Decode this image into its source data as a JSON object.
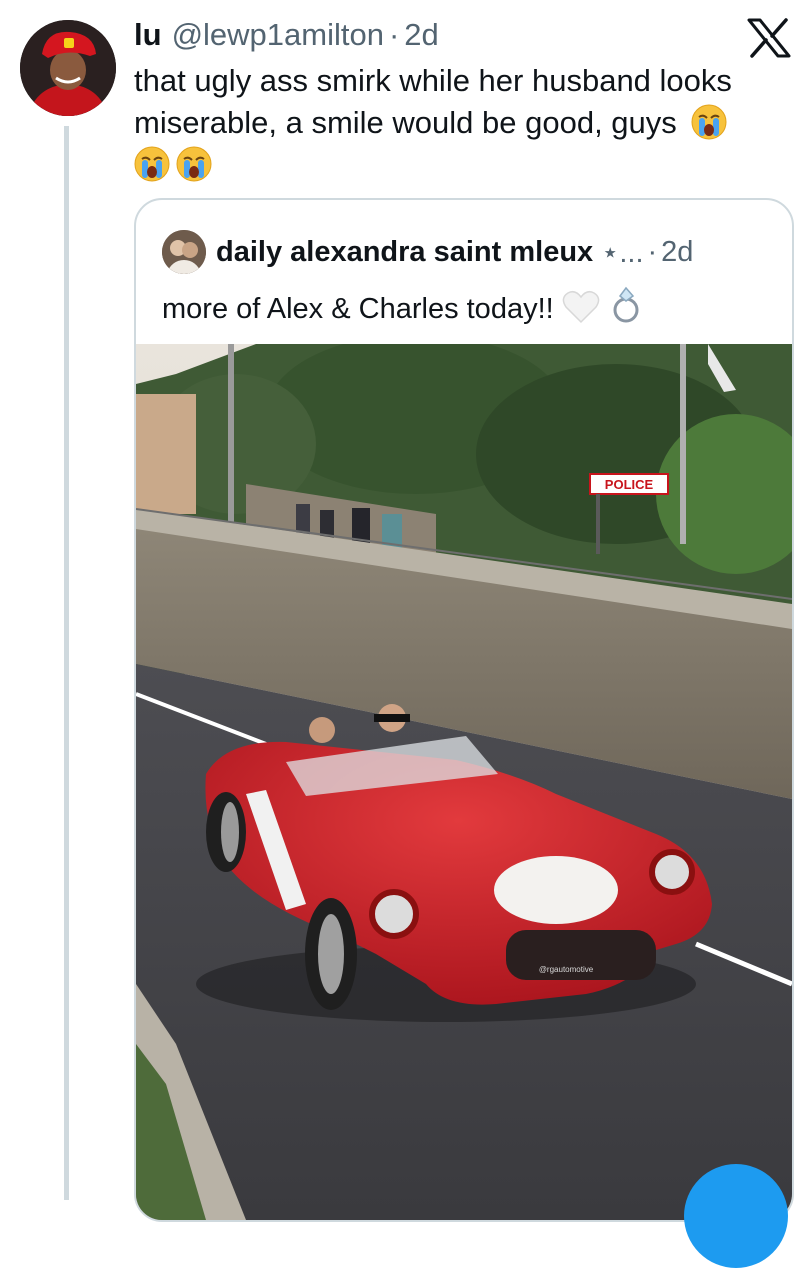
{
  "tweet": {
    "author_name": "lu",
    "author_handle": "@lewp1amilton",
    "separator": "·",
    "time": "2d",
    "text": "that ugly ass smirk while her husband looks miserable, a smile would be good, guys"
  },
  "quote": {
    "author_name": "daily alexandra saint mleux",
    "name_overflow": "⋆...",
    "separator": "·",
    "time": "2d",
    "text": "more of Alex & Charles today!!",
    "media": {
      "sign_text": "POLICE",
      "watermark": "@rgautomotive"
    }
  },
  "icons": {
    "platform_logo": "x-logo-icon",
    "tweet_emoji": "loudly-crying-face-icon",
    "quote_emojis": [
      "white-heart-icon",
      "ring-icon"
    ]
  },
  "colors": {
    "text_primary": "#0f1419",
    "text_secondary": "#536471",
    "border": "#cfd9de",
    "accent_blue": "#1d9bf0",
    "car_red": "#c8141c"
  }
}
